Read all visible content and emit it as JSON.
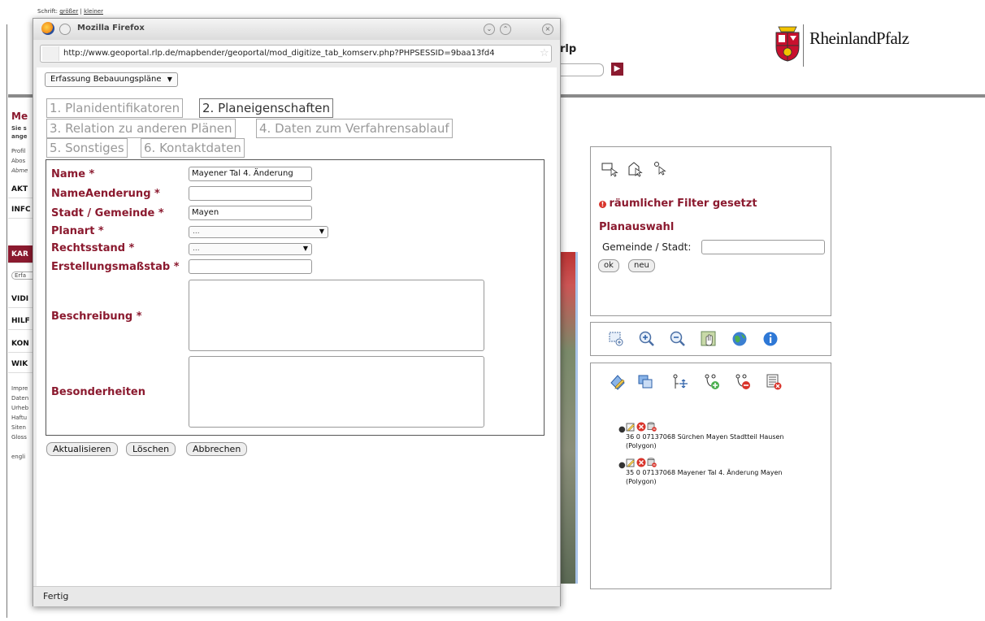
{
  "site": {
    "font_label": "Schrift:",
    "font_bigger": "größer",
    "font_smaller": "kleiner",
    "logo_text": "RheinlandPfalz",
    "partial_rlp": "rlp",
    "go_icon": "arrow-right-icon"
  },
  "left_menu": {
    "heading": "Me",
    "sub1": "Sie s",
    "sub2": "ange",
    "links": [
      "Profil",
      "Abos",
      "Abme"
    ],
    "items": [
      "AKT",
      "INFC",
      "KAR",
      "VIDI",
      "HILF",
      "KON",
      "WIK"
    ],
    "chip": "Erfa",
    "footer_links": [
      "Impre",
      "Daten",
      "Urheb",
      "Haftu",
      "Siten",
      "Gloss"
    ],
    "lang": "engli"
  },
  "right_panel": {
    "filter_text": "räumlicher Filter gesetzt",
    "title": "Planauswahl",
    "gemeinde_label": "Gemeinde / Stadt:",
    "gemeinde_value": "",
    "ok_label": "ok",
    "new_label": "neu",
    "plans": [
      {
        "line1": "36 0 07137068 Sürchen Mayen Stadtteil Hausen",
        "line2": "(Polygon)"
      },
      {
        "line1": "35 0 07137068 Mayener Tal 4. Änderung Mayen",
        "line2": "(Polygon)"
      }
    ]
  },
  "popup": {
    "title": "Mozilla Firefox",
    "url": "http://www.geoportal.rlp.de/mapbender/geoportal/mod_digitize_tab_komserv.php?PHPSESSID=9baa13fd4",
    "status": "Fertig",
    "mode_select": "Erfassung Bebauungspläne",
    "tabs": [
      "1. Planidentifikatoren",
      "2. Planeigenschaften",
      "3. Relation zu anderen Plänen",
      "4. Daten zum Verfahrensablauf",
      "5. Sonstiges",
      "6. Kontaktdaten"
    ],
    "form": {
      "name_label": "Name *",
      "name_value": "Mayener Tal 4. Änderung",
      "nameaenderung_label": "NameAenderung *",
      "nameaenderung_value": "",
      "stadt_label": "Stadt / Gemeinde *",
      "stadt_value": "Mayen",
      "planart_label": "Planart *",
      "planart_value": "...",
      "rechtsstand_label": "Rechtsstand *",
      "rechtsstand_value": "...",
      "massstab_label": "Erstellungsmaßstab *",
      "massstab_value": "",
      "beschreibung_label": "Beschreibung *",
      "besonderheiten_label": "Besonderheiten"
    },
    "buttons": {
      "update": "Aktualisieren",
      "delete": "Löschen",
      "cancel": "Abbrechen"
    }
  },
  "colors": {
    "accent": "#8b1a2f",
    "panel_border": "#999999"
  }
}
